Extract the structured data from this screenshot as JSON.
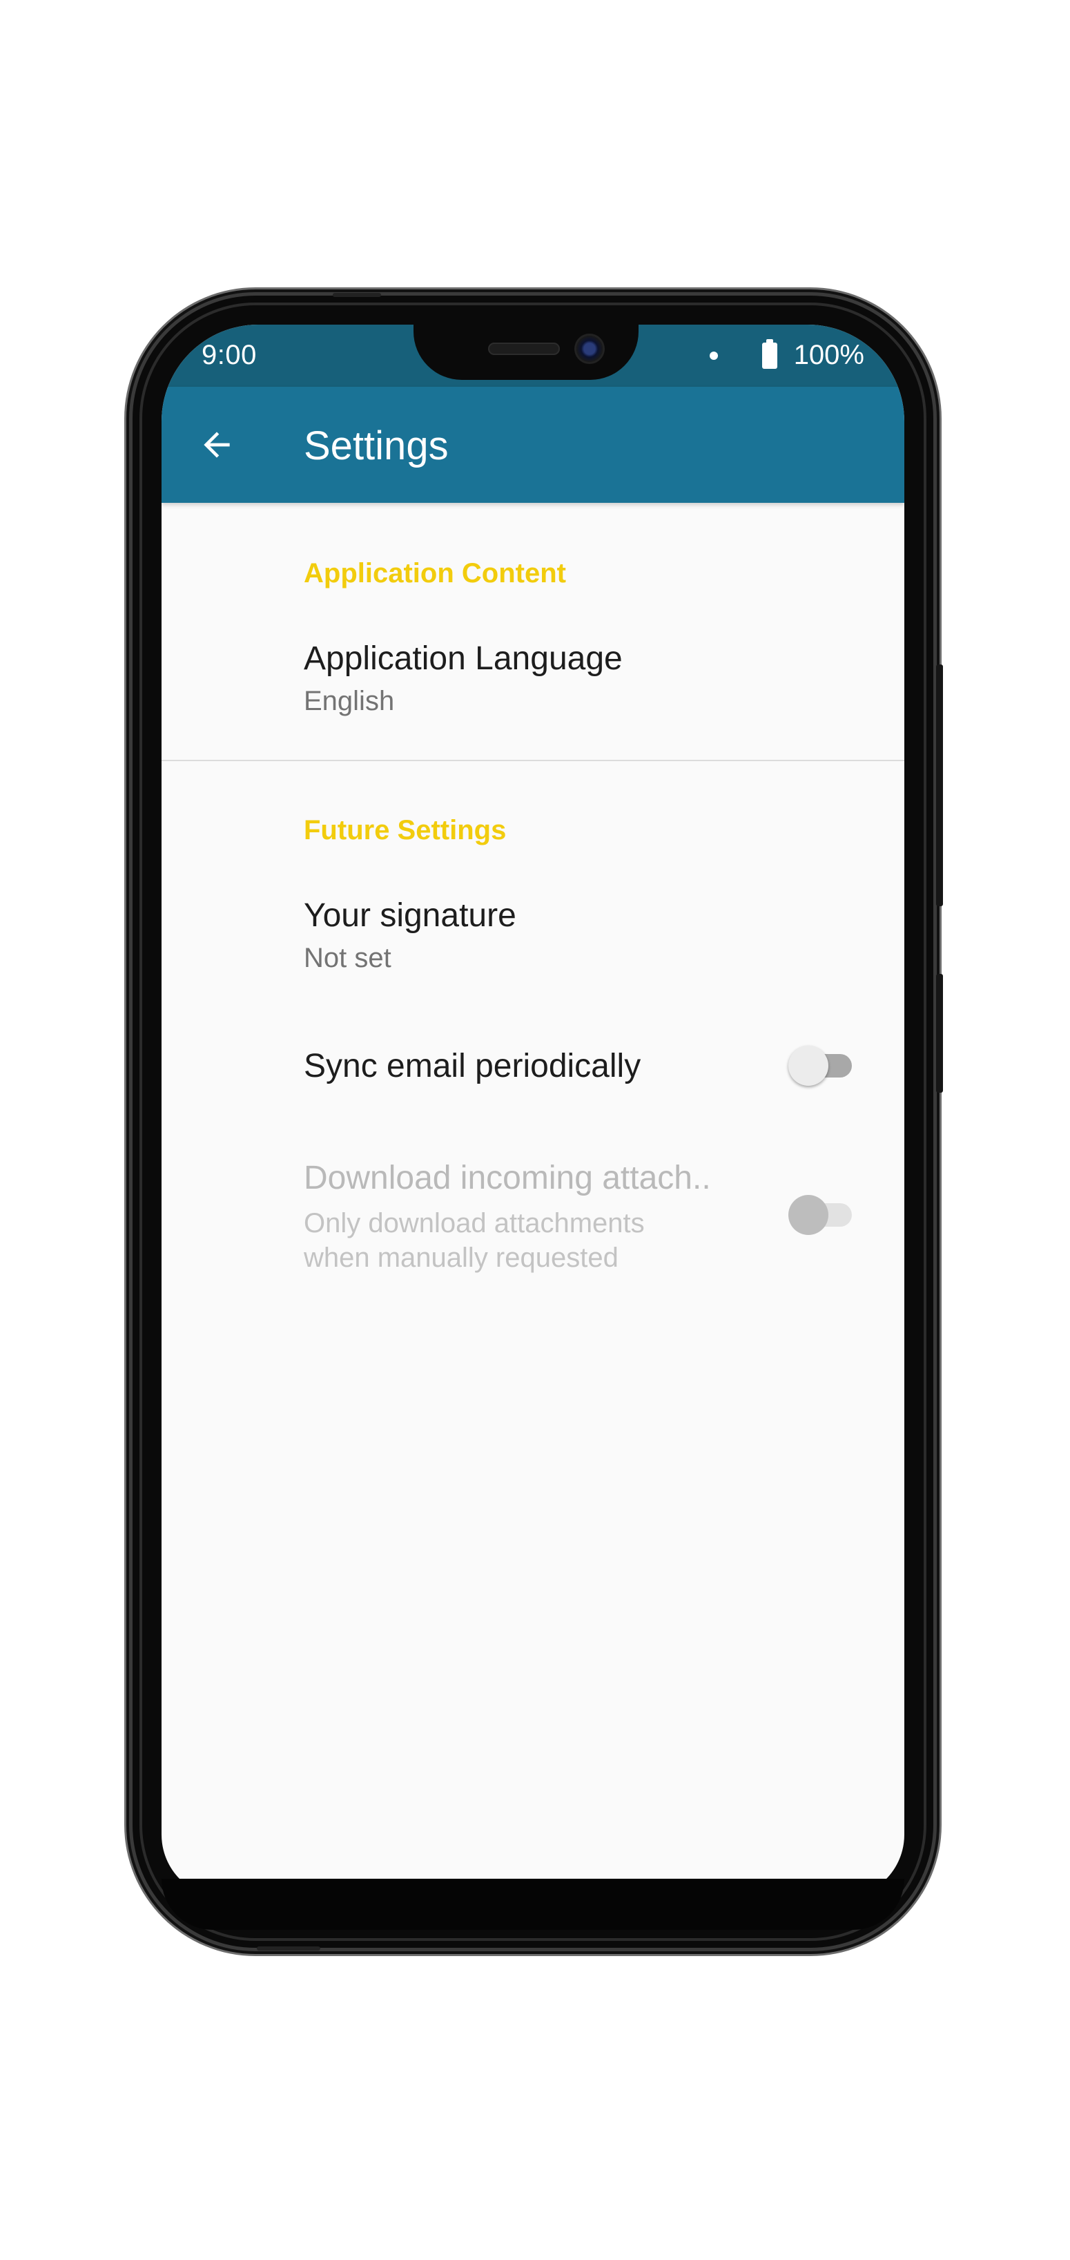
{
  "status_bar": {
    "time": "9:00",
    "battery": "100%",
    "notification_icon": "dot-icon",
    "battery_icon": "battery-icon"
  },
  "app_bar": {
    "title": "Settings",
    "back_icon": "arrow-back-icon",
    "background_color": "#1a7396",
    "status_bar_color": "#17607a"
  },
  "sections": [
    {
      "header": "Application Content",
      "items": [
        {
          "title": "Application Language",
          "summary": "English"
        }
      ]
    },
    {
      "header": "Future Settings",
      "items": [
        {
          "title": "Your signature",
          "summary": "Not set"
        },
        {
          "title": "Sync email periodically",
          "switch_on": false
        },
        {
          "title": "Download incoming attach..",
          "summary": "Only download attachments when manually requested",
          "switch_on": false,
          "enabled": false
        }
      ]
    }
  ],
  "accent_color": "#f2cc0d"
}
